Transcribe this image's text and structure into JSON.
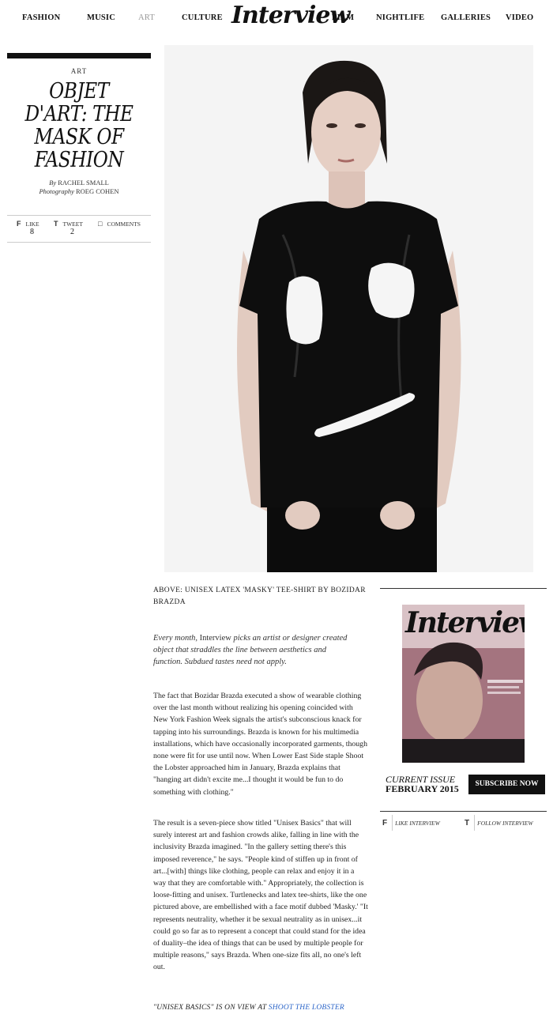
{
  "nav": {
    "items": [
      "FASHION",
      "MUSIC",
      "ART",
      "CULTURE",
      "FILM",
      "NIGHTLIFE",
      "GALLERIES",
      "VIDEO"
    ],
    "active": "ART",
    "logo": "Interview"
  },
  "article": {
    "category": "ART",
    "headline": "OBJET D'ART: THE MASK OF FASHION",
    "by_label": "By",
    "author": "RACHEL SMALL",
    "photo_label": "Photography",
    "photographer": "ROEG COHEN",
    "social": {
      "like_label": "LIKE",
      "like_count": "8",
      "tweet_label": "TWEET",
      "tweet_count": "2",
      "comments_label": "COMMENTS"
    },
    "caption": "ABOVE: UNISEX LATEX 'MASKY' TEE-SHIRT BY BOZIDAR BRAZDA",
    "intro_pre": "Every month, ",
    "intro_mag": "Interview",
    "intro_post": " picks an artist or designer created object that straddles the line between aesthetics and function. Subdued tastes need not apply.",
    "paragraph_1": "The fact that Bozidar Brazda executed a show of wearable clothing over the last month without realizing his opening coincided with New York Fashion Week signals the artist's subconscious knack for tapping into his surroundings. Brazda is known for his multimedia installations, which have occasionally incorporated garments, though none were fit for use until now. When Lower East Side staple Shoot the Lobster approached him in January, Brazda explains that \"hanging art didn't excite me...I thought it would be fun to do something with clothing.\"",
    "paragraph_2": "The result is a seven-piece show titled \"Unisex Basics\" that will surely interest art and fashion crowds alike, falling in line with the inclusivity Brazda imagined. \"In the gallery setting there's this imposed reverence,\" he says. \"People kind of stiffen up in front of art...[with] things like clothing, people can relax and enjoy it in a way that they are comfortable with.\" Appropriately, the collection is loose-fitting and unisex. Turtlenecks and latex tee-shirts, like the one pictured above, are embellished with a face motif dubbed 'Masky.' \"It represents neutrality, whether it be sexual neutrality as in unisex...it could go so far as to represent a concept that could stand for the idea of duality–the idea of things that can be used by multiple people for multiple reasons,\" says Brazda. When one-size fits all, no one's left out.",
    "onview_text": "\"UNISEX BASICS\" IS ON VIEW AT ",
    "onview_link": "SHOOT THE LOBSTER"
  },
  "sidebar": {
    "cover_title": "Interview",
    "current_label": "CURRENT ISSUE",
    "current_date": "FEBRUARY 2015",
    "subscribe_label": "SUBSCRIBE NOW",
    "like_interview": "LIKE INTERVIEW",
    "follow_interview": "FOLLOW INTERVIEW"
  },
  "colors": {
    "link": "#2a64c8",
    "black": "#111111"
  }
}
